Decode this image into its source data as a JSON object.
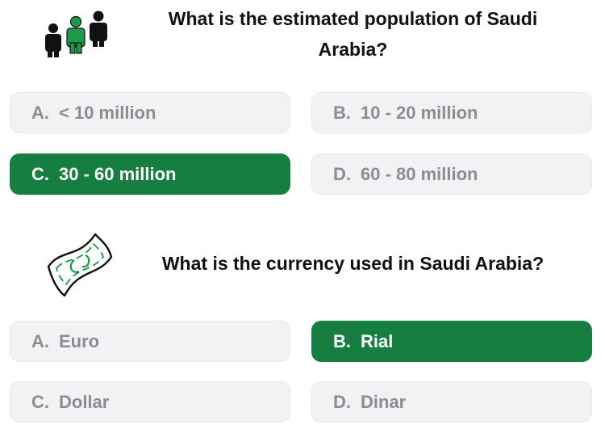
{
  "quiz": {
    "questions": [
      {
        "icon": "people-icon",
        "text": "What is the estimated population of Saudi Arabia?",
        "options": [
          {
            "letter": "A.",
            "label": "< 10 million",
            "selected": false
          },
          {
            "letter": "B.",
            "label": "10 - 20 million",
            "selected": false
          },
          {
            "letter": "C.",
            "label": "30 - 60 million",
            "selected": true
          },
          {
            "letter": "D.",
            "label": "60 - 80 million",
            "selected": false
          }
        ]
      },
      {
        "icon": "banknote-icon",
        "text": "What is the currency used in Saudi Arabia?",
        "options": [
          {
            "letter": "A.",
            "label": "Euro",
            "selected": false
          },
          {
            "letter": "B.",
            "label": "Rial",
            "selected": true
          },
          {
            "letter": "C.",
            "label": "Dollar",
            "selected": false
          },
          {
            "letter": "D.",
            "label": "Dinar",
            "selected": false
          }
        ]
      }
    ]
  },
  "colors": {
    "selected": "#167e40",
    "unselected": "#f1f2f4",
    "unselected_text": "#8a8d92",
    "icon_accent": "#1a9a4a"
  }
}
